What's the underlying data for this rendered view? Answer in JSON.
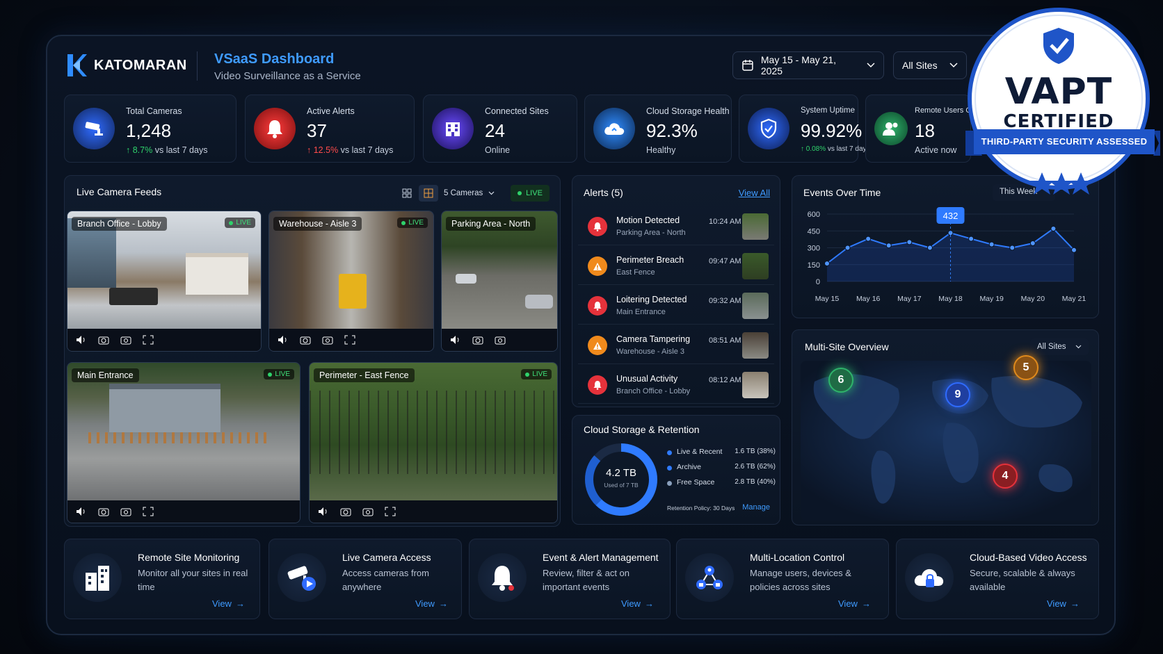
{
  "brand": {
    "name": "KATOMARAN"
  },
  "header": {
    "title": "VSaaS Dashboard",
    "subtitle": "Video Surveillance as a Service",
    "date_range": "May 15 - May 21, 2025",
    "site_filter": "All Sites"
  },
  "stats": [
    {
      "label": "Total Cameras",
      "value": "1,248",
      "change": "8.7%",
      "suffix": "vs last 7 days"
    },
    {
      "label": "Active Alerts",
      "value": "37",
      "change": "12.5%",
      "suffix": "vs last 7 days"
    },
    {
      "label": "Connected Sites",
      "value": "24",
      "status": "Online"
    },
    {
      "label": "Cloud Storage Health",
      "value": "92.3%",
      "status": "Healthy"
    },
    {
      "label": "System Uptime",
      "value": "99.92%",
      "change": "0.08%",
      "suffix": "vs last 7 days"
    },
    {
      "label": "Remote Users Online",
      "value": "18",
      "status": "Active now"
    }
  ],
  "feeds": {
    "title": "Live Camera Feeds",
    "camera_count": "5 Cameras",
    "live_label": "LIVE",
    "cameras": [
      {
        "name": "Branch Office - Lobby",
        "live": "LIVE"
      },
      {
        "name": "Warehouse - Aisle 3",
        "live": "LIVE"
      },
      {
        "name": "Parking Area - North"
      },
      {
        "name": "Main Entrance",
        "live": "LIVE"
      },
      {
        "name": "Perimeter - East Fence",
        "live": "LIVE"
      }
    ]
  },
  "alerts": {
    "title": "Alerts (5)",
    "view_all": "View All",
    "items": [
      {
        "title": "Motion Detected",
        "location": "Parking Area - North",
        "time": "10:24 AM",
        "color": "#e5323b"
      },
      {
        "title": "Perimeter Breach",
        "location": "East Fence",
        "time": "09:47 AM",
        "color": "#f08a1c"
      },
      {
        "title": "Loitering Detected",
        "location": "Main Entrance",
        "time": "09:32 AM",
        "color": "#e5323b"
      },
      {
        "title": "Camera Tampering",
        "location": "Warehouse - Aisle 3",
        "time": "08:51 AM",
        "color": "#f08a1c"
      },
      {
        "title": "Unusual Activity",
        "location": "Branch Office - Lobby",
        "time": "08:12 AM",
        "color": "#e5323b"
      }
    ]
  },
  "storage": {
    "title": "Cloud Storage & Retention",
    "total": "4.2 TB",
    "used_of": "Used of 7 TB",
    "items": [
      {
        "label": "Live & Recent",
        "value": "1.6 TB (38%)",
        "color": "#2f7bff"
      },
      {
        "label": "Archive",
        "value": "2.6 TB (62%)",
        "color": "#2f7bff"
      },
      {
        "label": "Free Space",
        "value": "2.8 TB (40%)",
        "color": "#8aa0bd"
      }
    ],
    "retention": "Retention Policy: 30 Days",
    "manage": "Manage"
  },
  "events": {
    "title": "Events Over Time",
    "range": "This Week"
  },
  "chart_data": {
    "type": "line",
    "title": "Events Over Time",
    "x": [
      "May 15",
      "May 16",
      "May 17",
      "May 18",
      "May 19",
      "May 20",
      "May 21"
    ],
    "series": [
      {
        "values": [
          160,
          300,
          380,
          320,
          350,
          300,
          432,
          380,
          330,
          300,
          340,
          470,
          280
        ]
      }
    ],
    "xlabel": "",
    "ylabel": "",
    "yticks": [
      0,
      150,
      300,
      450,
      600
    ],
    "ylim": [
      0,
      600
    ],
    "highlight": {
      "label": "432"
    },
    "grid": true
  },
  "multisite": {
    "title": "Multi-Site Overview",
    "filter": "All Sites",
    "markers": [
      {
        "count": "6",
        "color": "#2fb36b"
      },
      {
        "count": "9",
        "color": "#2f6bff"
      },
      {
        "count": "5",
        "color": "#e08a1c"
      },
      {
        "count": "4",
        "color": "#e5323b"
      }
    ]
  },
  "features": [
    {
      "title": "Remote Site Monitoring",
      "desc": "Monitor all your sites in real time",
      "link": "View",
      "icon": "buildings-icon"
    },
    {
      "title": "Live Camera Access",
      "desc": "Access cameras from anywhere",
      "link": "View",
      "icon": "camera-play-icon"
    },
    {
      "title": "Event & Alert Management",
      "desc": "Review, filter & act on important events",
      "link": "View",
      "icon": "bell-icon"
    },
    {
      "title": "Multi-Location Control",
      "desc": "Manage users, devices & policies across sites",
      "link": "View",
      "icon": "network-icon"
    },
    {
      "title": "Cloud-Based Video Access",
      "desc": "Secure, scalable & always available",
      "link": "View",
      "icon": "cloud-lock-icon"
    }
  ],
  "badge": {
    "line1": "VAPT",
    "line2": "CERTIFIED",
    "ribbon": "THIRD-PARTY SECURITY ASSESSED"
  }
}
